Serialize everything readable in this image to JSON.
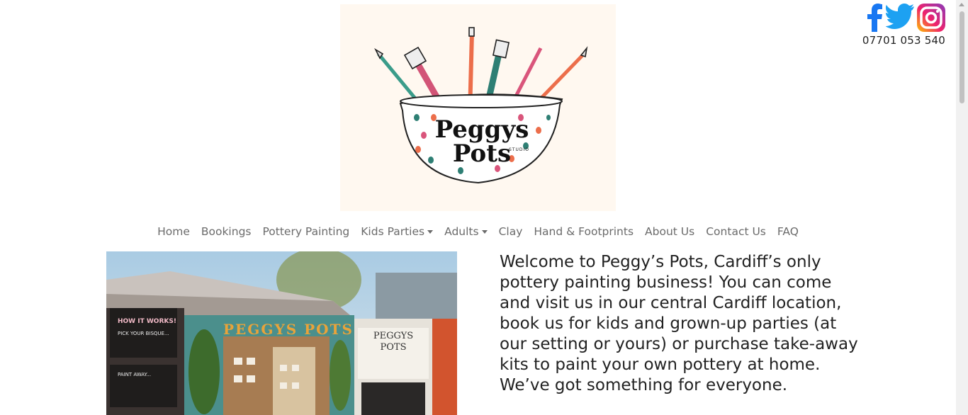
{
  "logo": {
    "brand_line1": "Peggys",
    "brand_line2": "Pots",
    "studio": "STUDIO"
  },
  "social": {
    "icons": [
      "facebook-icon",
      "twitter-icon",
      "instagram-icon"
    ],
    "phone": "07701 053 540"
  },
  "nav": {
    "items": [
      {
        "label": "Home",
        "dropdown": false
      },
      {
        "label": "Bookings",
        "dropdown": false
      },
      {
        "label": "Pottery Painting",
        "dropdown": false
      },
      {
        "label": "Kids Parties",
        "dropdown": true
      },
      {
        "label": "Adults",
        "dropdown": true
      },
      {
        "label": "Clay",
        "dropdown": false
      },
      {
        "label": "Hand & Footprints",
        "dropdown": false
      },
      {
        "label": "About Us",
        "dropdown": false
      },
      {
        "label": "Contact Us",
        "dropdown": false
      },
      {
        "label": "FAQ",
        "dropdown": false
      }
    ]
  },
  "photo": {
    "sign_text": "PEGGYS POTS",
    "board_title": "HOW IT WORKS!",
    "board_step1": "PICK YOUR BISQUE...",
    "board_step2": "PAINT AWAY...",
    "poster_title": "PEGGYS POTS"
  },
  "welcome": {
    "text": "Welcome to Peggy’s Pots, Cardiff’s only pottery painting business! You can come and visit us in our central Cardiff location, book us for kids and grown-up parties (at our setting or yours) or purchase take-away kits to paint your own pottery at home. We’ve got something for everyone."
  },
  "colors": {
    "facebook": "#1877f2",
    "twitter": "#1da1f2",
    "nav_text": "#6b6b6b",
    "logo_bg": "#fff8f0"
  }
}
